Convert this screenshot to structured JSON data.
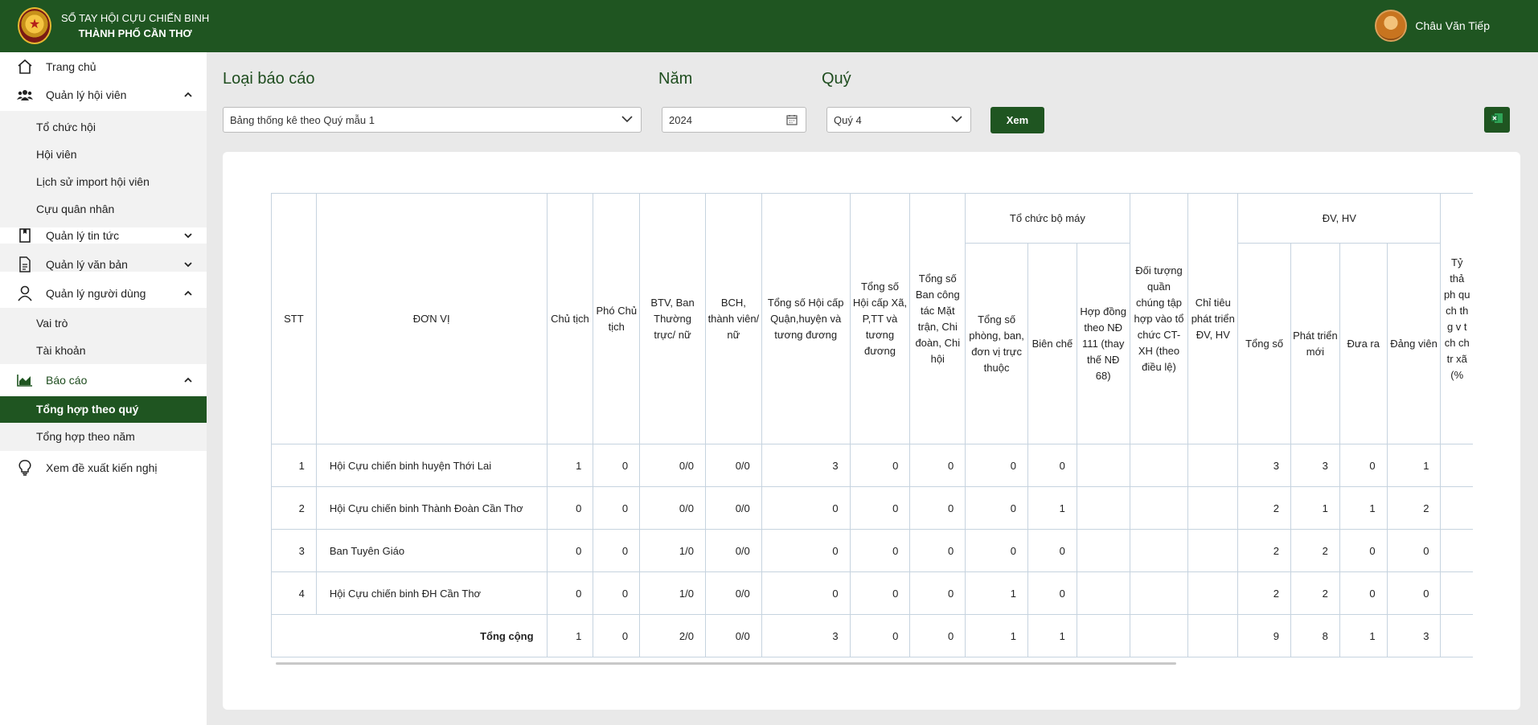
{
  "header": {
    "brand_line1": "SỔ TAY HỘI CỰU CHIẾN BINH",
    "brand_line2": "THÀNH PHỐ CẦN THƠ",
    "user_name": "Châu Văn Tiếp"
  },
  "sidebar": {
    "home": "Trang chủ",
    "members_group": "Quản lý hội viên",
    "members_items": [
      "Tổ chức hội",
      "Hội viên",
      "Lịch sử import hội viên",
      "Cựu quân nhân"
    ],
    "news": "Quản lý tin tức",
    "docs": "Quản lý văn bản",
    "users_group": "Quản lý người dùng",
    "users_items": [
      "Vai trò",
      "Tài khoản"
    ],
    "reports_group": "Báo cáo",
    "reports_items": [
      "Tổng hợp theo quý",
      "Tổng hợp theo năm"
    ],
    "suggest": "Xem đề xuất kiến nghị"
  },
  "filters": {
    "report_type_label": "Loại báo cáo",
    "report_type_value": "Bảng thống kê theo Quý mẫu 1",
    "year_label": "Năm",
    "year_value": "2024",
    "quarter_label": "Quý",
    "quarter_value": "Quý 4",
    "view_button": "Xem"
  },
  "table": {
    "headers": {
      "stt": "STT",
      "unit": "ĐƠN VỊ",
      "chairman": "Chủ tịch",
      "vice_chairman": "Phó Chủ tịch",
      "btv": "BTV, Ban Thường trực/ nữ",
      "bch": "BCH, thành viên/ nữ",
      "district_assoc": "Tổng số Hội cấp Quận,huyện và tương đương",
      "ward_assoc": "Tổng số Hội cấp Xã, P,TT và tương đương",
      "front_committees": "Tổng số Ban công tác Mặt trận, Chi đoàn, Chi hội",
      "org_group": "Tổ chức bộ máy",
      "org_departments": "Tổng số phòng, ban, đơn vị trực thuộc",
      "org_staff": "Biên chế",
      "org_contracts": "Hợp đồng theo NĐ 111 (thay thế NĐ 68)",
      "mass_targets": "Đối tượng quần chúng tập hợp vào tổ chức CT-XH (theo điều lệ)",
      "dev_target": "Chỉ tiêu phát triển ĐV, HV",
      "dvhv_group": "ĐV, HV",
      "dvhv_total": "Tổng số",
      "dvhv_new": "Phát triển mới",
      "dvhv_out": "Đưa ra",
      "dvhv_party": "Đảng viên",
      "ratio_partial": "Tỷ thả ph qu ch th g v t ch ch tr xã (%"
    },
    "rows": [
      {
        "stt": "1",
        "unit": "Hội Cựu chiến binh huyện Thới Lai",
        "chairman": "1",
        "vice": "0",
        "btv": "0/0",
        "bch": "0/0",
        "district": "3",
        "ward": "0",
        "front": "0",
        "depts": "0",
        "staff": "0",
        "contracts": "",
        "mass": "",
        "dev": "",
        "total": "3",
        "new": "3",
        "out": "0",
        "party": "1"
      },
      {
        "stt": "2",
        "unit": "Hội Cựu chiến binh Thành Đoàn Cần Thơ",
        "chairman": "0",
        "vice": "0",
        "btv": "0/0",
        "bch": "0/0",
        "district": "0",
        "ward": "0",
        "front": "0",
        "depts": "0",
        "staff": "1",
        "contracts": "",
        "mass": "",
        "dev": "",
        "total": "2",
        "new": "1",
        "out": "1",
        "party": "2"
      },
      {
        "stt": "3",
        "unit": "Ban Tuyên Giáo",
        "chairman": "0",
        "vice": "0",
        "btv": "1/0",
        "bch": "0/0",
        "district": "0",
        "ward": "0",
        "front": "0",
        "depts": "0",
        "staff": "0",
        "contracts": "",
        "mass": "",
        "dev": "",
        "total": "2",
        "new": "2",
        "out": "0",
        "party": "0"
      },
      {
        "stt": "4",
        "unit": "Hội Cựu chiến binh ĐH Cần Thơ",
        "chairman": "0",
        "vice": "0",
        "btv": "1/0",
        "bch": "0/0",
        "district": "0",
        "ward": "0",
        "front": "0",
        "depts": "1",
        "staff": "0",
        "contracts": "",
        "mass": "",
        "dev": "",
        "total": "2",
        "new": "2",
        "out": "0",
        "party": "0"
      }
    ],
    "total": {
      "label": "Tổng cộng",
      "chairman": "1",
      "vice": "0",
      "btv": "2/0",
      "bch": "0/0",
      "district": "3",
      "ward": "0",
      "front": "0",
      "depts": "1",
      "staff": "1",
      "contracts": "",
      "mass": "",
      "dev": "",
      "total": "9",
      "new": "8",
      "out": "1",
      "party": "3"
    }
  },
  "colors": {
    "brand_green": "#1f5521",
    "border": "#c6d3df"
  }
}
